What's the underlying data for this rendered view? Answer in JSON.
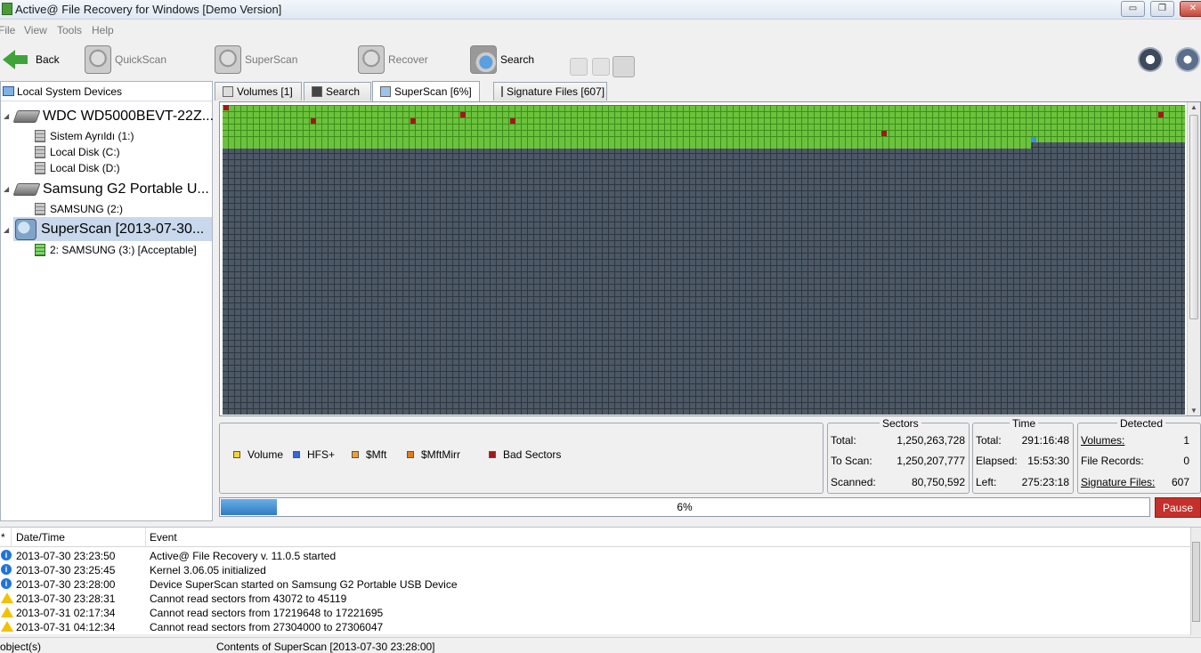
{
  "window": {
    "title": "Active@ File Recovery for Windows [Demo Version]",
    "buttons": {
      "minimize": "▭",
      "restore": "❐",
      "close": "✕"
    }
  },
  "menu": [
    "File",
    "View",
    "Tools",
    "Help"
  ],
  "toolbar": {
    "back": "Back",
    "quickscan": "QuickScan",
    "superscan": "SuperScan",
    "recover": "Recover",
    "search": "Search"
  },
  "left_panel": {
    "header": "Local System Devices",
    "tree": [
      {
        "label": "WDC WD5000BEVT-22Z...",
        "icon": "hard-drive-icon",
        "level": 0
      },
      {
        "label": "Sistem Ayrıldı (1:)",
        "icon": "volume-icon",
        "level": 1
      },
      {
        "label": "Local Disk (C:)",
        "icon": "volume-icon",
        "level": 1
      },
      {
        "label": "Local Disk (D:)",
        "icon": "volume-icon",
        "level": 1
      },
      {
        "label": "Samsung G2 Portable U...",
        "icon": "hard-drive-icon",
        "level": 0
      },
      {
        "label": "SAMSUNG (2:)",
        "icon": "volume-icon",
        "level": 1
      },
      {
        "label": "SuperScan [2013-07-30...",
        "icon": "superscan-icon",
        "level": 0,
        "selected": true
      },
      {
        "label": "2: SAMSUNG (3:) [Acceptable]",
        "icon": "green-volume-icon",
        "level": 1
      }
    ]
  },
  "tabs": [
    {
      "label": "Volumes [1]",
      "icon": "volumes-tab-icon"
    },
    {
      "label": "Search",
      "icon": "search-tab-icon"
    },
    {
      "label": "SuperScan [6%]",
      "icon": "superscan-tab-icon",
      "active": true
    },
    {
      "label": "Signature Files [607]",
      "icon": "signature-files-tab-icon"
    }
  ],
  "legend": [
    {
      "label": "Volume",
      "color": "#f2d43a"
    },
    {
      "label": "HFS+",
      "color": "#3a64d8"
    },
    {
      "label": "$Mft",
      "color": "#f0a030"
    },
    {
      "label": "$MftMirr",
      "color": "#d9801a"
    },
    {
      "label": "Bad Sectors",
      "color": "#a01818"
    }
  ],
  "sectors": {
    "title": "Sectors",
    "total_label": "Total:",
    "total": "1,250,263,728",
    "toscan_label": "To Scan:",
    "toscan": "1,250,207,777",
    "scanned_label": "Scanned:",
    "scanned": "80,750,592"
  },
  "time": {
    "title": "Time",
    "total_label": "Total:",
    "total": "291:16:48",
    "elapsed_label": "Elapsed:",
    "elapsed": "15:53:30",
    "left_label": "Left:",
    "left": "275:23:18"
  },
  "detected": {
    "title": "Detected",
    "volumes_label": "Volumes:",
    "volumes": "1",
    "records_label": "File Records:",
    "records": "0",
    "sig_label": "Signature Files:",
    "sig": "607"
  },
  "progress": {
    "text": "6%",
    "fraction": 0.06
  },
  "pause": "Pause",
  "log": {
    "columns": [
      "*",
      "Date/Time",
      "Event"
    ],
    "rows": [
      {
        "type": "info",
        "datetime": "2013-07-30 23:23:50",
        "event": "Active@ File Recovery v. 11.0.5 started"
      },
      {
        "type": "info",
        "datetime": "2013-07-30 23:25:45",
        "event": "Kernel 3.06.05 initialized"
      },
      {
        "type": "info",
        "datetime": "2013-07-30 23:28:00",
        "event": "Device SuperScan started on Samsung G2 Portable USB Device"
      },
      {
        "type": "warn",
        "datetime": "2013-07-30 23:28:31",
        "event": "Cannot read sectors from 43072 to 45119"
      },
      {
        "type": "warn",
        "datetime": "2013-07-31 02:17:34",
        "event": "Cannot read sectors from 17219648 to 17221695"
      },
      {
        "type": "warn",
        "datetime": "2013-07-31 04:12:34",
        "event": "Cannot read sectors from 27304000 to 27306047"
      }
    ]
  },
  "status": {
    "objects": "object(s)",
    "contents": "Contents of SuperScan [2013-07-30 23:28:00]"
  },
  "colors": {
    "scanned": "#6cc23c",
    "unscanned": "#4c5866",
    "bad_sector": "#a01818",
    "hfs": "#3a64d8",
    "pause": "#c4302b",
    "progress": "#2f7bc2"
  }
}
